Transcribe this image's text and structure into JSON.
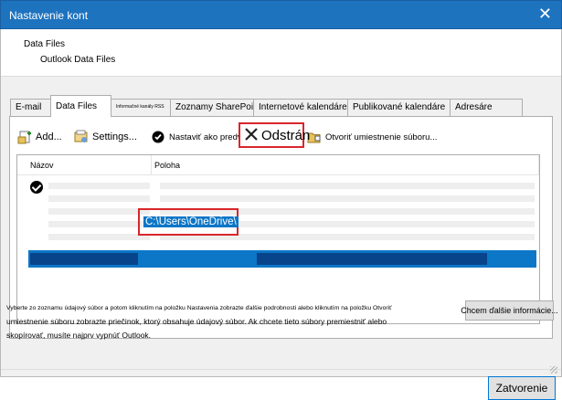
{
  "window": {
    "title": "Nastavenie kont",
    "close_glyph": "✕"
  },
  "header": {
    "title": "Data Files",
    "subtitle": "Outlook Data Files"
  },
  "tabs": [
    {
      "label": "E-mail",
      "active": false
    },
    {
      "label": "Data Files",
      "active": true
    },
    {
      "label": "Informačné kanály RSS",
      "active": false
    },
    {
      "label": "Zoznamy SharePointu",
      "active": false
    },
    {
      "label": "Internetové kalendáre",
      "active": false
    },
    {
      "label": "Publikované kalendáre",
      "active": false
    },
    {
      "label": "Adresáre",
      "active": false
    }
  ],
  "toolbar": {
    "add": "Add...",
    "settings": "Settings...",
    "set_default": "Nastaviť ako predvol",
    "remove": "Odstrán",
    "open_location": "Otvoriť umiestnenie súboru..."
  },
  "list": {
    "columns": {
      "name": "Názov",
      "location": "Poloha"
    },
    "selected_path": "C:\\Users\\OneDrive\\"
  },
  "description": {
    "line1": "Vyberte zo zoznamu údajový súbor a potom kliknutím na položku Nastavenia zobrazte ďalšie podrobnosti alebo kliknutím na položku Otvoriť",
    "line2": "umiestnenie súboru zobrazte priečinok, ktorý obsahuje údajový súbor. Ak chcete tieto súbory premiestniť alebo",
    "line3": "skopírovať, musíte najprv vypnúť Outlook."
  },
  "buttons": {
    "more_info": "Chcem ďalšie informácie...",
    "close": "Zatvorenie"
  },
  "colors": {
    "accent": "#1e73bf",
    "selection": "#0c76c7",
    "highlight_box": "#d9262c"
  }
}
